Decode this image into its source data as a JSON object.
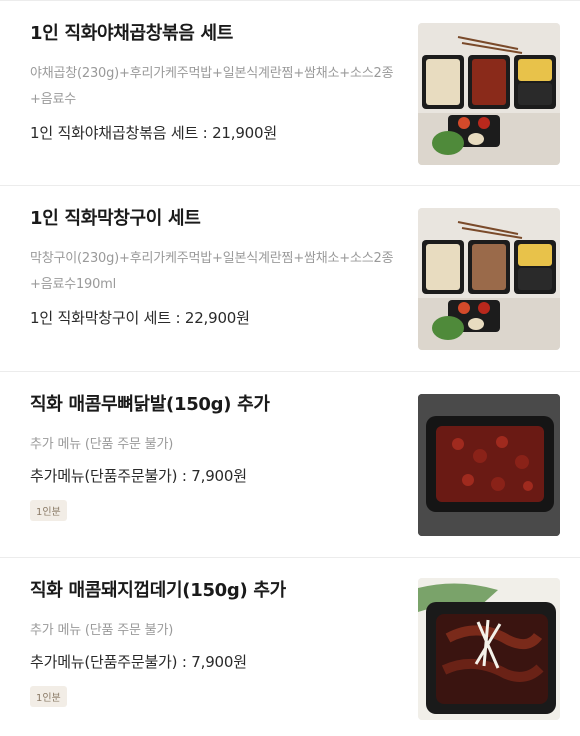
{
  "menu_items": [
    {
      "name": "1인 직화야채곱창볶음 세트",
      "description": "야채곱창(230g)+후리가케주먹밥+일본식계란찜+쌈채소+소스2종+음료수",
      "price_line": "1인 직화야채곱창볶음 세트 : 21,900원",
      "badge": ""
    },
    {
      "name": "1인 직화막창구이 세트",
      "description": "막창구이(230g)+후리가케주먹밥+일본식계란찜+쌈채소+소스2종+음료수190ml",
      "price_line": "1인 직화막창구이 세트 : 22,900원",
      "badge": ""
    },
    {
      "name": "직화 매콤무뼈닭발(150g) 추가",
      "description": "추가 메뉴 (단품 주문 불가)",
      "price_line": "추가메뉴(단품주문불가) : 7,900원",
      "badge": "1인분"
    },
    {
      "name": "직화 매콤돼지껍데기(150g) 추가",
      "description": "추가 메뉴 (단품 주문 불가)",
      "price_line": "추가메뉴(단품주문불가) : 7,900원",
      "badge": "1인분"
    }
  ]
}
